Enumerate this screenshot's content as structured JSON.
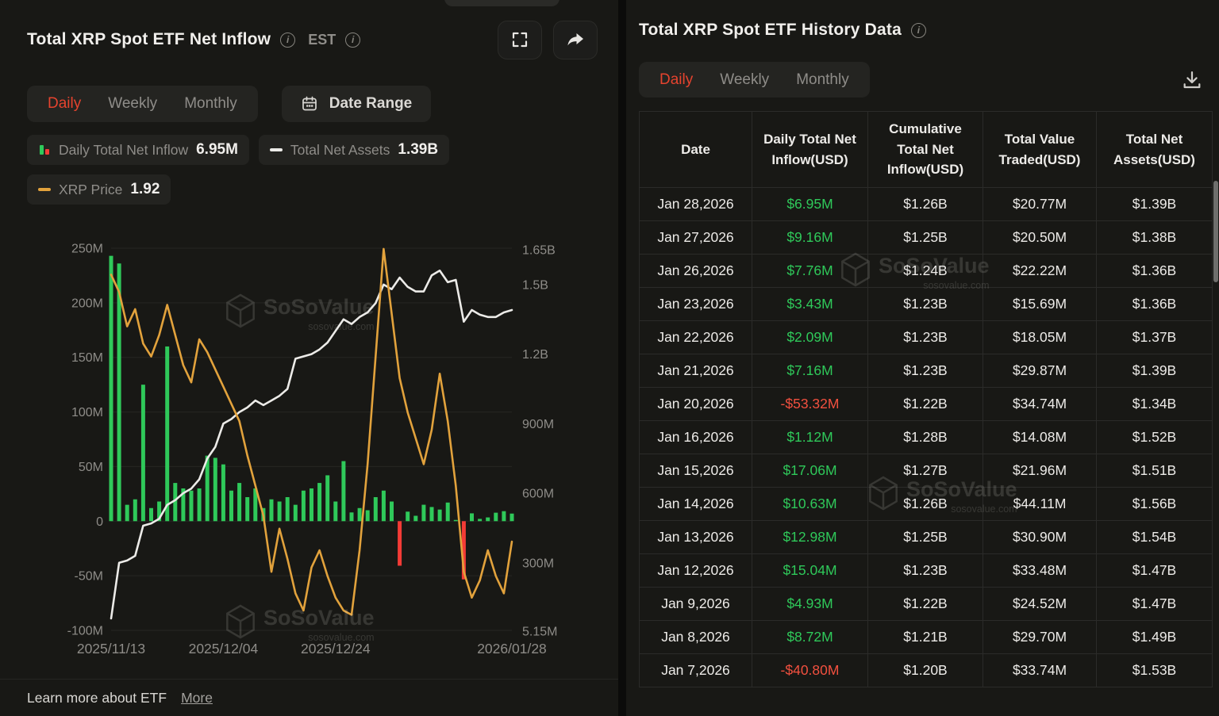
{
  "left_panel": {
    "title": "Total XRP Spot ETF Net Inflow",
    "est_label": "EST",
    "tabs": {
      "daily": "Daily",
      "weekly": "Weekly",
      "monthly": "Monthly"
    },
    "date_range_label": "Date Range",
    "legend": {
      "inflow_label": "Daily Total Net Inflow",
      "inflow_value": "6.95M",
      "assets_label": "Total Net Assets",
      "assets_value": "1.39B",
      "price_label": "XRP Price",
      "price_value": "1.92"
    },
    "footer": {
      "text": "Learn more about ETF",
      "link": "More"
    }
  },
  "right_panel": {
    "title": "Total XRP Spot ETF History Data",
    "tabs": {
      "daily": "Daily",
      "weekly": "Weekly",
      "monthly": "Monthly"
    },
    "table": {
      "headers": [
        "Date",
        "Daily Total Net Inflow(USD)",
        "Cumulative Total Net Inflow(USD)",
        "Total Value Traded(USD)",
        "Total Net Assets(USD)"
      ],
      "rows": [
        {
          "date": "Jan 28,2026",
          "inflow": "$6.95M",
          "negative": false,
          "cumulative": "$1.26B",
          "traded": "$20.77M",
          "assets": "$1.39B"
        },
        {
          "date": "Jan 27,2026",
          "inflow": "$9.16M",
          "negative": false,
          "cumulative": "$1.25B",
          "traded": "$20.50M",
          "assets": "$1.38B"
        },
        {
          "date": "Jan 26,2026",
          "inflow": "$7.76M",
          "negative": false,
          "cumulative": "$1.24B",
          "traded": "$22.22M",
          "assets": "$1.36B"
        },
        {
          "date": "Jan 23,2026",
          "inflow": "$3.43M",
          "negative": false,
          "cumulative": "$1.23B",
          "traded": "$15.69M",
          "assets": "$1.36B"
        },
        {
          "date": "Jan 22,2026",
          "inflow": "$2.09M",
          "negative": false,
          "cumulative": "$1.23B",
          "traded": "$18.05M",
          "assets": "$1.37B"
        },
        {
          "date": "Jan 21,2026",
          "inflow": "$7.16M",
          "negative": false,
          "cumulative": "$1.23B",
          "traded": "$29.87M",
          "assets": "$1.39B"
        },
        {
          "date": "Jan 20,2026",
          "inflow": "-$53.32M",
          "negative": true,
          "cumulative": "$1.22B",
          "traded": "$34.74M",
          "assets": "$1.34B"
        },
        {
          "date": "Jan 16,2026",
          "inflow": "$1.12M",
          "negative": false,
          "cumulative": "$1.28B",
          "traded": "$14.08M",
          "assets": "$1.52B"
        },
        {
          "date": "Jan 15,2026",
          "inflow": "$17.06M",
          "negative": false,
          "cumulative": "$1.27B",
          "traded": "$21.96M",
          "assets": "$1.51B"
        },
        {
          "date": "Jan 14,2026",
          "inflow": "$10.63M",
          "negative": false,
          "cumulative": "$1.26B",
          "traded": "$44.11M",
          "assets": "$1.56B"
        },
        {
          "date": "Jan 13,2026",
          "inflow": "$12.98M",
          "negative": false,
          "cumulative": "$1.25B",
          "traded": "$30.90M",
          "assets": "$1.54B"
        },
        {
          "date": "Jan 12,2026",
          "inflow": "$15.04M",
          "negative": false,
          "cumulative": "$1.23B",
          "traded": "$33.48M",
          "assets": "$1.47B"
        },
        {
          "date": "Jan 9,2026",
          "inflow": "$4.93M",
          "negative": false,
          "cumulative": "$1.22B",
          "traded": "$24.52M",
          "assets": "$1.47B"
        },
        {
          "date": "Jan 8,2026",
          "inflow": "$8.72M",
          "negative": false,
          "cumulative": "$1.21B",
          "traded": "$29.70M",
          "assets": "$1.49B"
        },
        {
          "date": "Jan 7,2026",
          "inflow": "-$40.80M",
          "negative": true,
          "cumulative": "$1.20B",
          "traded": "$33.74M",
          "assets": "$1.53B"
        }
      ]
    }
  },
  "watermark": {
    "name": "SoSoValue",
    "domain": "sosovalue.com"
  },
  "colors": {
    "accent_red": "#E5432E",
    "value_green": "#2FC95A",
    "value_red": "#F2503F",
    "chart_green": "#2FC95A",
    "chart_red": "#F43B36",
    "assets_line": "#ECEBE8",
    "price_line": "#E2A23C",
    "panel_bg": "#181815"
  },
  "chart_data": {
    "type": "mixed-bar-line",
    "title": "Total XRP Spot ETF Net Inflow",
    "x_tick_labels": [
      "2025/11/13",
      "2025/12/04",
      "2025/12/24",
      "2026/01/28"
    ],
    "x_tick_indices": [
      0,
      14,
      28,
      50
    ],
    "left_axis": {
      "label": "Daily Total Net Inflow (USD)",
      "ticks": [
        "250M",
        "200M",
        "150M",
        "100M",
        "50M",
        "0",
        "-50M",
        "-100M"
      ],
      "tick_values_m": [
        250,
        200,
        150,
        100,
        50,
        0,
        -50,
        -100
      ],
      "range_m": [
        -100,
        250
      ]
    },
    "right_axis": {
      "label": "Total Net Assets (USD)",
      "ticks": [
        "1.65B",
        "1.5B",
        "1.2B",
        "900M",
        "600M",
        "300M",
        "5.15M"
      ],
      "tick_values_m": [
        1650,
        1500,
        1200,
        900,
        600,
        300,
        5.15
      ],
      "range_m": [
        5.15,
        1650
      ]
    },
    "price_axis_range": [
      1.69,
      2.62
    ],
    "grid": true,
    "legend_position": "top",
    "dates": [
      "2025/11/13",
      "2025/11/14",
      "2025/11/17",
      "2025/11/18",
      "2025/11/19",
      "2025/11/20",
      "2025/11/21",
      "2025/11/24",
      "2025/11/25",
      "2025/11/26",
      "2025/11/28",
      "2025/12/01",
      "2025/12/02",
      "2025/12/03",
      "2025/12/04",
      "2025/12/05",
      "2025/12/08",
      "2025/12/09",
      "2025/12/10",
      "2025/12/11",
      "2025/12/12",
      "2025/12/15",
      "2025/12/16",
      "2025/12/17",
      "2025/12/18",
      "2025/12/19",
      "2025/12/22",
      "2025/12/23",
      "2025/12/24",
      "2025/12/26",
      "2025/12/29",
      "2025/12/30",
      "2025/12/31",
      "2026/01/02",
      "2026/01/05",
      "2026/01/06",
      "2026/01/07",
      "2026/01/08",
      "2026/01/09",
      "2026/01/12",
      "2026/01/13",
      "2026/01/14",
      "2026/01/15",
      "2026/01/16",
      "2026/01/20",
      "2026/01/21",
      "2026/01/22",
      "2026/01/23",
      "2026/01/26",
      "2026/01/27",
      "2026/01/28"
    ],
    "series": [
      {
        "name": "Daily Total Net Inflow",
        "type": "bar",
        "unit": "USD M",
        "values": [
          243,
          236,
          15,
          20,
          125,
          12,
          18,
          160,
          35,
          30,
          28,
          30,
          60,
          58,
          52,
          28,
          35,
          22,
          30,
          12,
          20,
          18,
          22,
          15,
          28,
          30,
          35,
          42,
          18,
          55,
          8,
          12,
          10,
          22,
          28,
          18,
          -40.8,
          8.72,
          4.93,
          15.04,
          12.98,
          10.63,
          17.06,
          1.12,
          -53.32,
          7.16,
          2.09,
          3.43,
          7.76,
          9.16,
          6.95
        ]
      },
      {
        "name": "Total Net Assets",
        "type": "line",
        "unit": "USD M",
        "values": [
          60,
          300,
          310,
          330,
          460,
          470,
          490,
          550,
          570,
          600,
          620,
          660,
          750,
          800,
          900,
          920,
          950,
          970,
          1000,
          980,
          1000,
          1020,
          1050,
          1180,
          1190,
          1200,
          1220,
          1250,
          1300,
          1350,
          1330,
          1360,
          1380,
          1420,
          1500,
          1480,
          1530,
          1490,
          1470,
          1470,
          1540,
          1560,
          1510,
          1520,
          1340,
          1390,
          1370,
          1360,
          1360,
          1380,
          1390
        ]
      },
      {
        "name": "XRP Price",
        "type": "line",
        "unit": "USD",
        "values": [
          2.54,
          2.5,
          2.42,
          2.46,
          2.38,
          2.35,
          2.4,
          2.47,
          2.4,
          2.33,
          2.29,
          2.39,
          2.36,
          2.32,
          2.28,
          2.24,
          2.2,
          2.12,
          2.05,
          1.98,
          1.85,
          1.95,
          1.88,
          1.8,
          1.76,
          1.86,
          1.9,
          1.84,
          1.79,
          1.76,
          1.75,
          1.9,
          2.1,
          2.35,
          2.6,
          2.45,
          2.3,
          2.22,
          2.16,
          2.1,
          2.18,
          2.31,
          2.2,
          2.05,
          1.85,
          1.79,
          1.83,
          1.9,
          1.84,
          1.8,
          1.92
        ]
      }
    ]
  }
}
